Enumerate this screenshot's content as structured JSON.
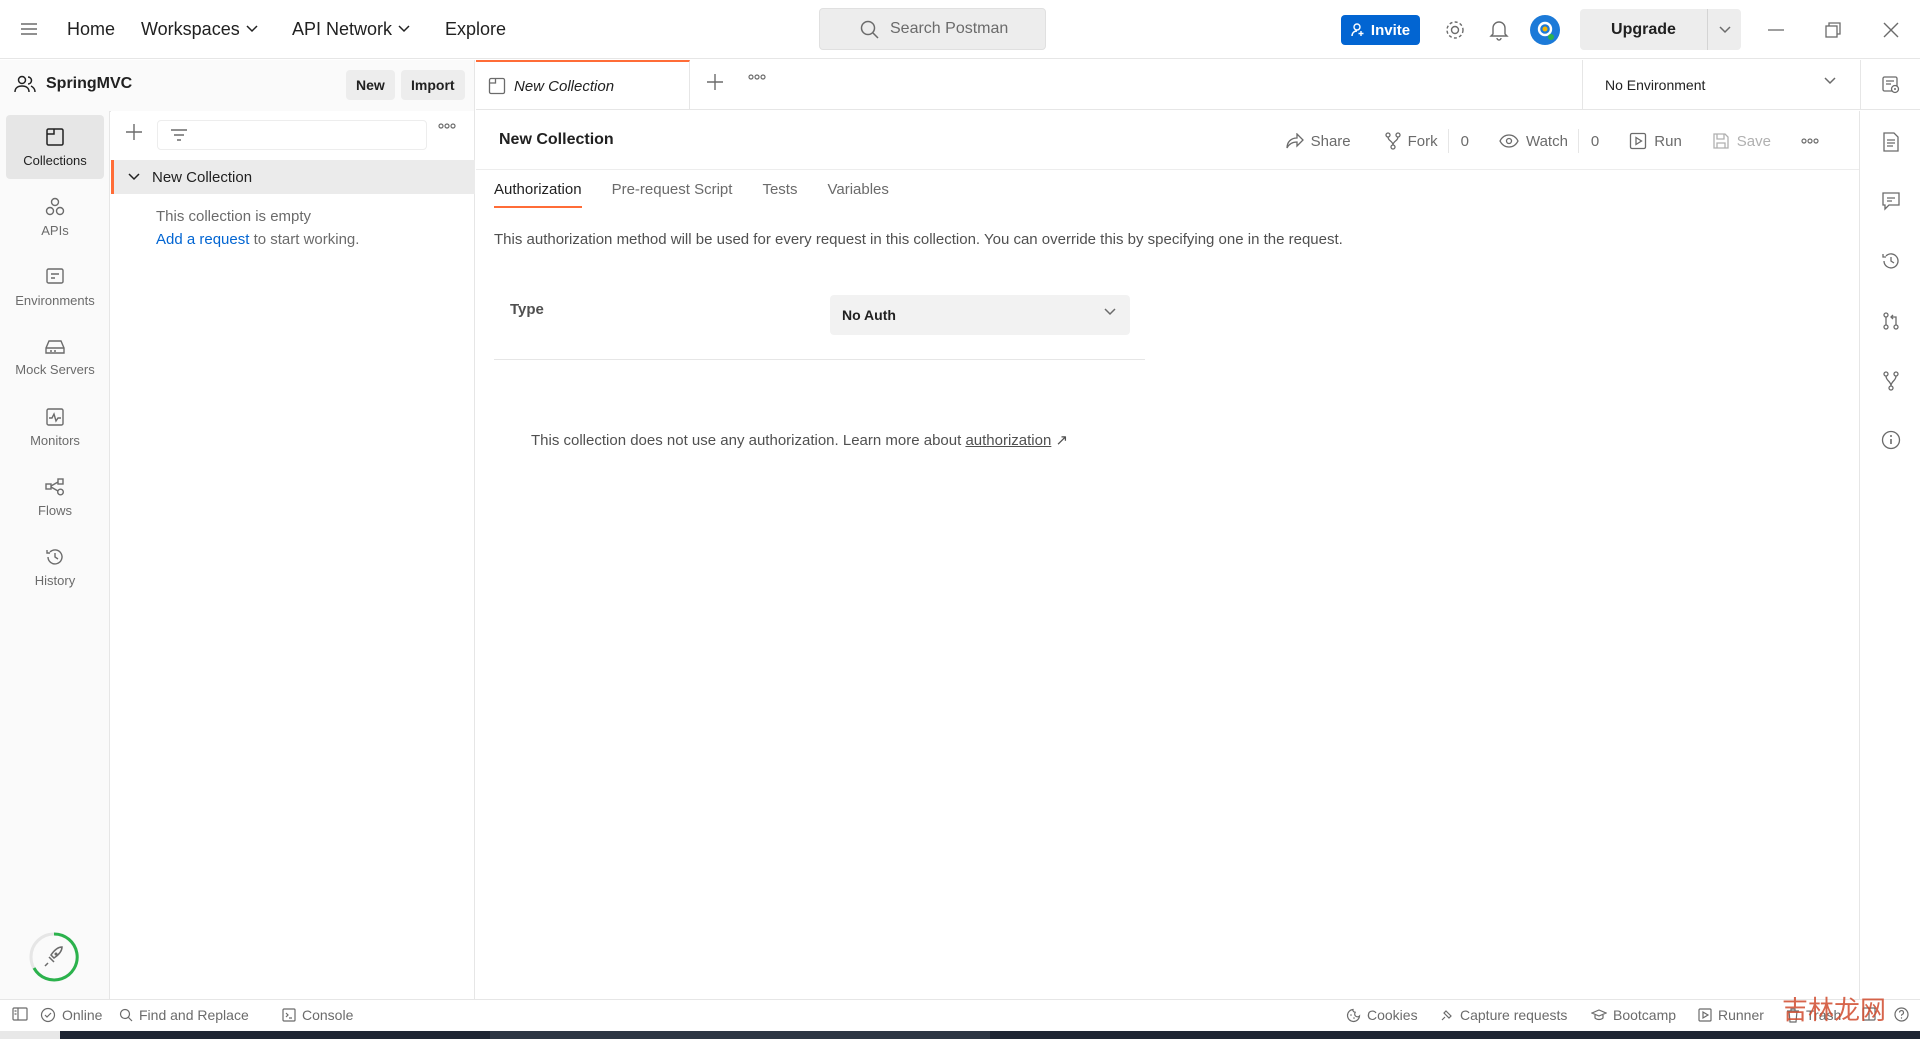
{
  "nav": {
    "home": "Home",
    "workspaces": "Workspaces",
    "api_network": "API Network",
    "explore": "Explore"
  },
  "search": {
    "placeholder": "Search Postman"
  },
  "header": {
    "invite_label": "Invite",
    "upgrade_label": "Upgrade"
  },
  "workspace": {
    "name": "SpringMVC",
    "new_label": "New",
    "import_label": "Import"
  },
  "rail": [
    {
      "label": "Collections",
      "icon": "collections-icon"
    },
    {
      "label": "APIs",
      "icon": "apis-icon"
    },
    {
      "label": "Environments",
      "icon": "environments-icon"
    },
    {
      "label": "Mock Servers",
      "icon": "mock-servers-icon"
    },
    {
      "label": "Monitors",
      "icon": "monitors-icon"
    },
    {
      "label": "Flows",
      "icon": "flows-icon"
    },
    {
      "label": "History",
      "icon": "history-icon"
    }
  ],
  "sidebar": {
    "collection_name": "New Collection",
    "empty_line1": "This collection is empty",
    "add_request_link": "Add a request",
    "empty_line2_rest": " to start working."
  },
  "tab": {
    "label": "New Collection"
  },
  "environment": {
    "selected": "No Environment"
  },
  "collection": {
    "title": "New Collection",
    "actions": {
      "share": "Share",
      "fork": "Fork",
      "fork_count": "0",
      "watch": "Watch",
      "watch_count": "0",
      "run": "Run",
      "save": "Save"
    },
    "tabs": [
      "Authorization",
      "Pre-request Script",
      "Tests",
      "Variables"
    ],
    "active_tab": "Authorization",
    "auth_description": "This authorization method will be used for every request in this collection. You can override this by specifying one in the request.",
    "type_label": "Type",
    "type_value": "No Auth",
    "noauth_text": "This collection does not use any authorization. Learn more about ",
    "noauth_link": "authorization",
    "noauth_arrow": "↗"
  },
  "statusbar": {
    "online": "Online",
    "find_replace": "Find and Replace",
    "console": "Console",
    "cookies": "Cookies",
    "capture": "Capture requests",
    "bootcamp": "Bootcamp",
    "runner": "Runner",
    "trash": "Trash"
  },
  "watermark": "吉林龙网",
  "colors": {
    "accent": "#ff6c37",
    "primary": "#0265d2",
    "progress": "#2bb24c"
  }
}
